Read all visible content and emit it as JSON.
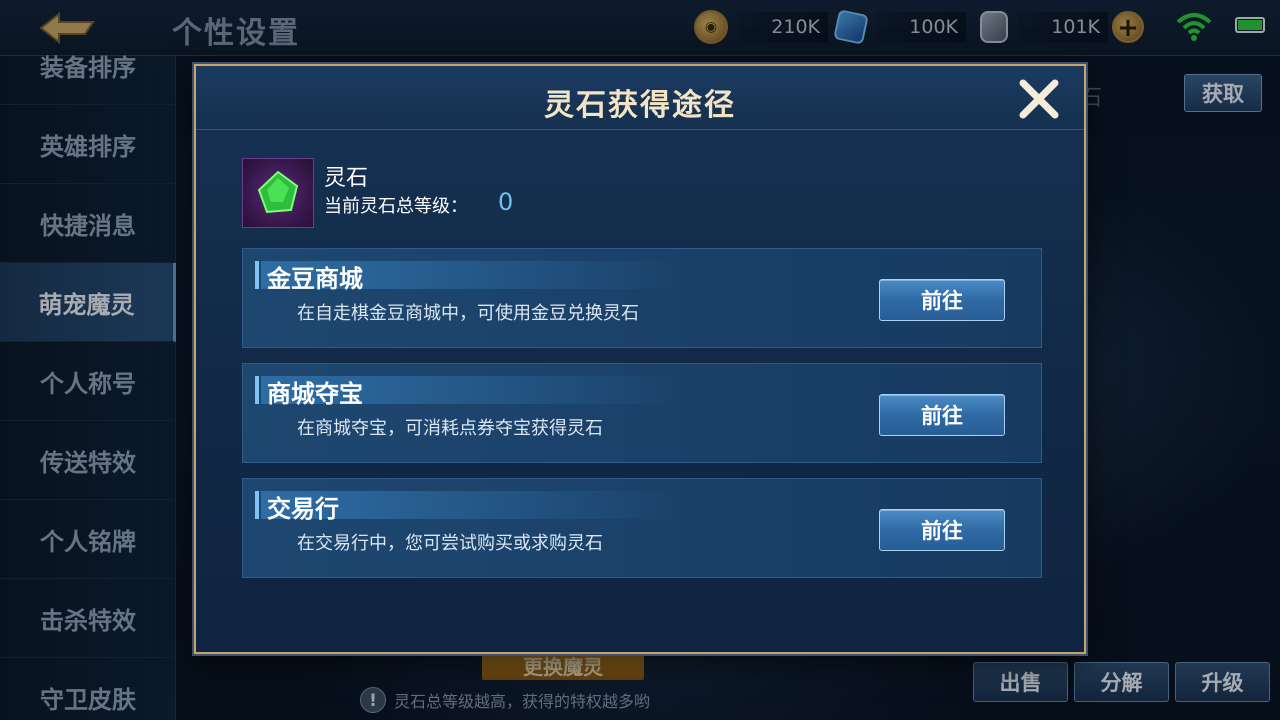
{
  "topbar": {
    "back_icon": "back-arrow-icon",
    "title": "个性设置",
    "gold": "210K",
    "diamond": "100K",
    "coupon": "101K",
    "plus_icon": "plus-icon"
  },
  "sidebar": {
    "items": [
      {
        "label": "装备排序"
      },
      {
        "label": "英雄排序"
      },
      {
        "label": "快捷消息"
      },
      {
        "label": "萌宠魔灵"
      },
      {
        "label": "个人称号"
      },
      {
        "label": "传送特效"
      },
      {
        "label": "个人铭牌"
      },
      {
        "label": "击杀特效"
      },
      {
        "label": "守卫皮肤"
      }
    ],
    "active": "萌宠魔灵"
  },
  "background": {
    "get_button": "获取",
    "partial_text": "石",
    "change_button": "更换魔灵",
    "hint": "灵石总等级越高，获得的特权越多哟",
    "bottom_buttons": [
      "出售",
      "分解",
      "升级"
    ]
  },
  "modal": {
    "title": "灵石获得途径",
    "item_name": "灵石",
    "level_label": "当前灵石总等级：",
    "level_value": "0",
    "sources": [
      {
        "title": "金豆商城",
        "desc": "在自走棋金豆商城中，可使用金豆兑换灵石",
        "button": "前往"
      },
      {
        "title": "商城夺宝",
        "desc": "在商城夺宝，可消耗点券夺宝获得灵石",
        "button": "前往"
      },
      {
        "title": "交易行",
        "desc": "在交易行中，您可尝试购买或求购灵石",
        "button": "前往"
      }
    ]
  },
  "colors": {
    "accent_gold": "#c6a56a",
    "level_value": "#6dc2f0",
    "button_blue": "#2f6aa4"
  }
}
